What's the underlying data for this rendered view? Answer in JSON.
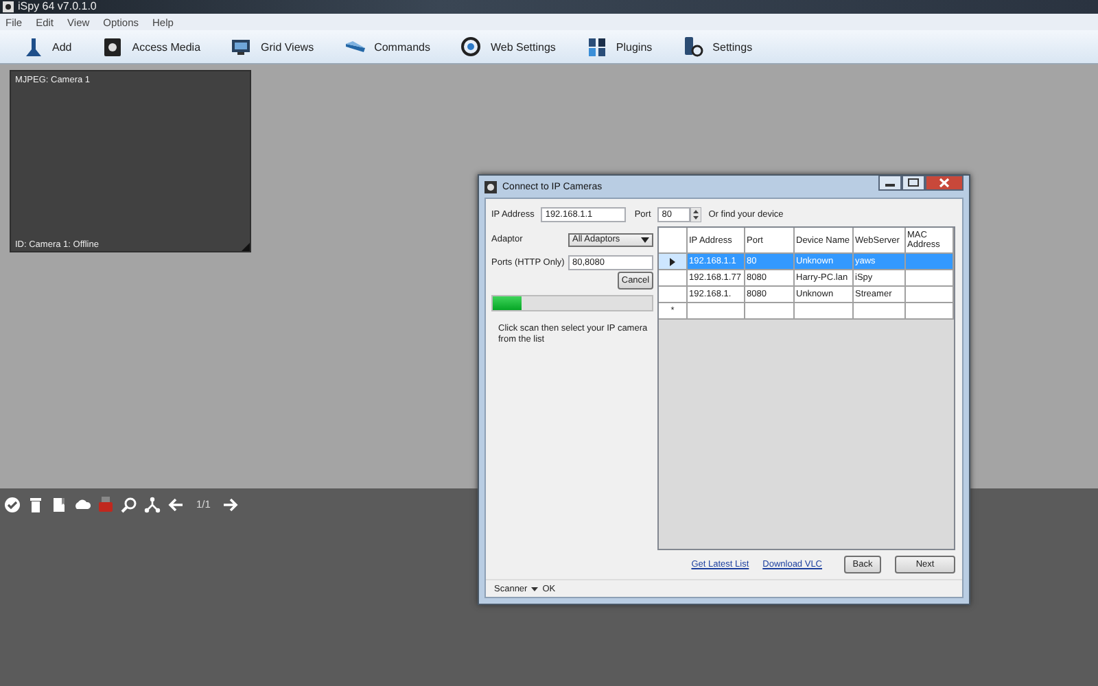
{
  "title_bar": {
    "title": "iSpy 64 v7.0.1.0"
  },
  "menu": [
    "File",
    "Edit",
    "View",
    "Options",
    "Help"
  ],
  "toolbar": [
    "Add",
    "Access Media",
    "Grid Views",
    "Commands",
    "Web Settings",
    "Plugins",
    "Settings"
  ],
  "camera_tile": {
    "title": "MJPEG: Camera 1",
    "status": "ID: Camera 1: Offline"
  },
  "bottom_toolbar": {
    "page": "1/1"
  },
  "dialog": {
    "title": "Connect to IP Cameras",
    "ip_label": "IP Address",
    "ip_value": "192.168.1.1",
    "port_label": "Port",
    "port_value": "80",
    "find_label": "Or find your device",
    "adaptor_label": "Adaptor",
    "adaptor_value": "All Adaptors",
    "ports_label": "Ports (HTTP Only)",
    "ports_value": "80,8080",
    "cancel": "Cancel",
    "progress": {
      "level": 0.18
    },
    "hint": "Click scan then select your IP camera from the list",
    "grid": {
      "columns": [
        "IP Address",
        "Port",
        "Device Name",
        "WebServer",
        "MAC Address"
      ],
      "rows": [
        {
          "selected": true,
          "cells": [
            "192.168.1.1",
            "80",
            "Unknown",
            "yaws",
            ""
          ]
        },
        {
          "selected": false,
          "cells": [
            "192.168.1.77",
            "8080",
            "Harry-PC.lan",
            "iSpy",
            ""
          ]
        },
        {
          "selected": false,
          "cells": [
            "192.168.1.",
            "8080",
            "Unknown",
            "Streamer",
            ""
          ]
        }
      ],
      "new_row_marker": "*"
    },
    "links": [
      "Get Latest List",
      "Download VLC"
    ],
    "buttons": [
      "Back",
      "Next"
    ],
    "status": {
      "label": "Scanner",
      "value": "OK"
    }
  }
}
